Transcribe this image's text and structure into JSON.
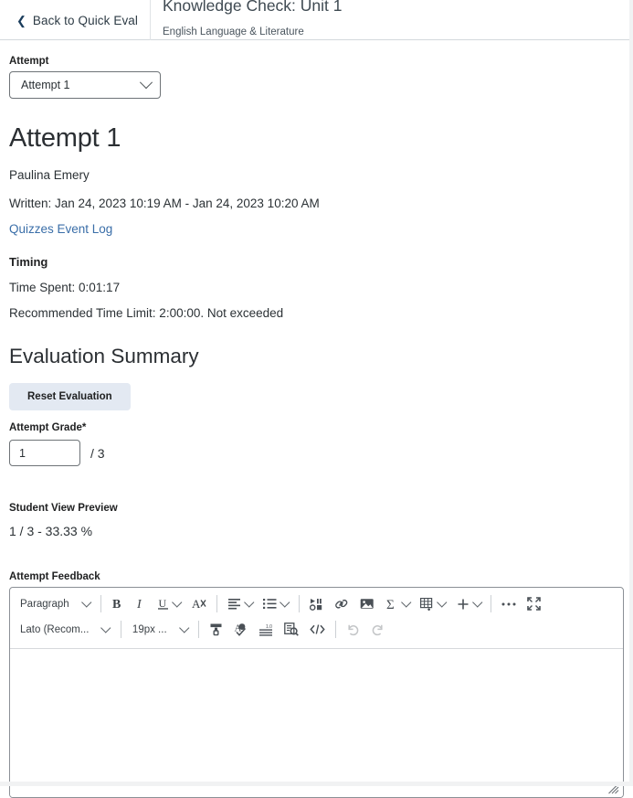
{
  "header": {
    "back_label": "Back to Quick Eval",
    "back_icon": "chevron-left-icon",
    "title": "Knowledge Check: Unit 1",
    "subtitle": "English Language & Literature"
  },
  "attempt_selector": {
    "label": "Attempt",
    "value": "Attempt 1",
    "icon": "chevron-down-icon"
  },
  "attempt": {
    "heading": "Attempt 1",
    "student_name": "Paulina Emery",
    "written": "Written: Jan 24, 2023 10:19 AM - Jan 24, 2023 10:20 AM",
    "event_log_link": "Quizzes Event Log",
    "timing_heading": "Timing",
    "time_spent": "Time Spent: 0:01:17",
    "time_limit": "Recommended Time Limit: 2:00:00. Not exceeded"
  },
  "evaluation": {
    "heading": "Evaluation Summary",
    "reset_button": "Reset Evaluation",
    "grade_label": "Attempt Grade",
    "required_marker": "*",
    "grade_value": "1",
    "grade_total": "/ 3",
    "preview_label": "Student View Preview",
    "preview_value": "1 / 3 - 33.33 %"
  },
  "feedback": {
    "label": "Attempt Feedback",
    "editor_content": "",
    "toolbar_row1": [
      {
        "name": "block-format-select",
        "label": "Paragraph",
        "icon": "chevron-down-icon",
        "type": "dropdown"
      },
      {
        "name": "bold-button",
        "label": "B",
        "icon": "bold-icon",
        "type": "icon"
      },
      {
        "name": "italic-button",
        "label": "I",
        "icon": "italic-icon",
        "type": "icon"
      },
      {
        "name": "underline-button",
        "label": "U",
        "icon": "underline-icon",
        "type": "icon-split"
      },
      {
        "name": "clear-formatting-button",
        "label": "",
        "icon": "clear-formatting-icon",
        "type": "icon"
      },
      {
        "name": "align-button",
        "label": "",
        "icon": "align-left-icon",
        "type": "icon-split"
      },
      {
        "name": "list-button",
        "label": "",
        "icon": "bulleted-list-icon",
        "type": "icon-split"
      },
      {
        "name": "media-button",
        "label": "",
        "icon": "media-icon",
        "type": "icon"
      },
      {
        "name": "link-button",
        "label": "",
        "icon": "link-icon",
        "type": "icon"
      },
      {
        "name": "image-button",
        "label": "",
        "icon": "image-icon",
        "type": "icon"
      },
      {
        "name": "equation-button",
        "label": "",
        "icon": "sigma-icon",
        "type": "icon-split"
      },
      {
        "name": "table-button",
        "label": "",
        "icon": "table-insert-icon",
        "type": "icon-split"
      },
      {
        "name": "insert-button",
        "label": "",
        "icon": "plus-icon",
        "type": "icon-split"
      },
      {
        "name": "more-options-button",
        "label": "",
        "icon": "ellipsis-icon",
        "type": "icon"
      },
      {
        "name": "fullscreen-button",
        "label": "",
        "icon": "fullscreen-icon",
        "type": "icon"
      }
    ],
    "toolbar_row2": [
      {
        "name": "font-family-select",
        "label": "Lato (Recom...",
        "icon": "chevron-down-icon",
        "type": "dropdown"
      },
      {
        "name": "font-size-select",
        "label": "19px ...",
        "icon": "chevron-down-icon",
        "type": "dropdown"
      },
      {
        "name": "format-painter-button",
        "label": "",
        "icon": "format-painter-icon",
        "type": "icon"
      },
      {
        "name": "spellcheck-button",
        "label": "",
        "icon": "spellcheck-icon",
        "type": "icon"
      },
      {
        "name": "line-height-button",
        "label": "",
        "icon": "line-height-icon",
        "type": "icon"
      },
      {
        "name": "accessibility-checker-button",
        "label": "",
        "icon": "accessibility-check-icon",
        "type": "icon"
      },
      {
        "name": "code-view-button",
        "label": "",
        "icon": "code-icon",
        "type": "icon"
      },
      {
        "name": "undo-button",
        "label": "",
        "icon": "undo-icon",
        "type": "icon",
        "disabled": true
      },
      {
        "name": "redo-button",
        "label": "",
        "icon": "redo-icon",
        "type": "icon",
        "disabled": true
      }
    ]
  },
  "colors": {
    "link": "#3a6ea8",
    "reset_button_bg": "#e3e9f2",
    "header_border": "#d4d8dd"
  }
}
